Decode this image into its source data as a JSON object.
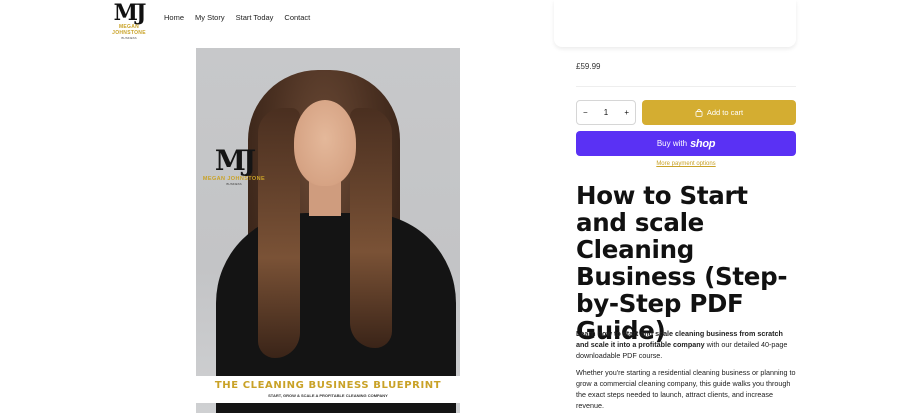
{
  "header": {
    "logo": {
      "mark": "MJ",
      "name": "MEGAN JOHNSTONE",
      "sub": "BUSINESS"
    },
    "nav": [
      "Home",
      "My Story",
      "Start Today",
      "Contact"
    ],
    "icons": [
      "search-icon",
      "account-icon",
      "cart-icon"
    ]
  },
  "product_image": {
    "logo_mark": "MJ",
    "logo_name": "MEGAN JOHNSTONE",
    "logo_sub": "BUSINESS",
    "banner_title": "THE CLEANING BUSINESS BLUEPRINT",
    "banner_sub": "START, GROW & SCALE A PROFITABLE CLEANING COMPANY"
  },
  "product": {
    "price": "£59.99",
    "quantity": "1",
    "qty_minus": "−",
    "qty_plus": "+",
    "add_to_cart": "Add to cart",
    "buy_with": "Buy with",
    "shop": "shop",
    "more_payment": "More payment options",
    "title": "How to Start and scale Cleaning Business (Step-by-Step PDF Guide)",
    "desc_bold": "Learn how to start and scale cleaning business from scratch and scale it into a profitable company",
    "desc_rest": " with our detailed 40-page downloadable PDF course.",
    "desc_p2": "Whether you're starting a residential cleaning business or planning to grow a commercial cleaning company, this guide walks you through the exact steps needed to launch, attract clients, and increase revenue."
  },
  "colors": {
    "gold": "#d4ad31",
    "shop_purple": "#5a31f4"
  }
}
